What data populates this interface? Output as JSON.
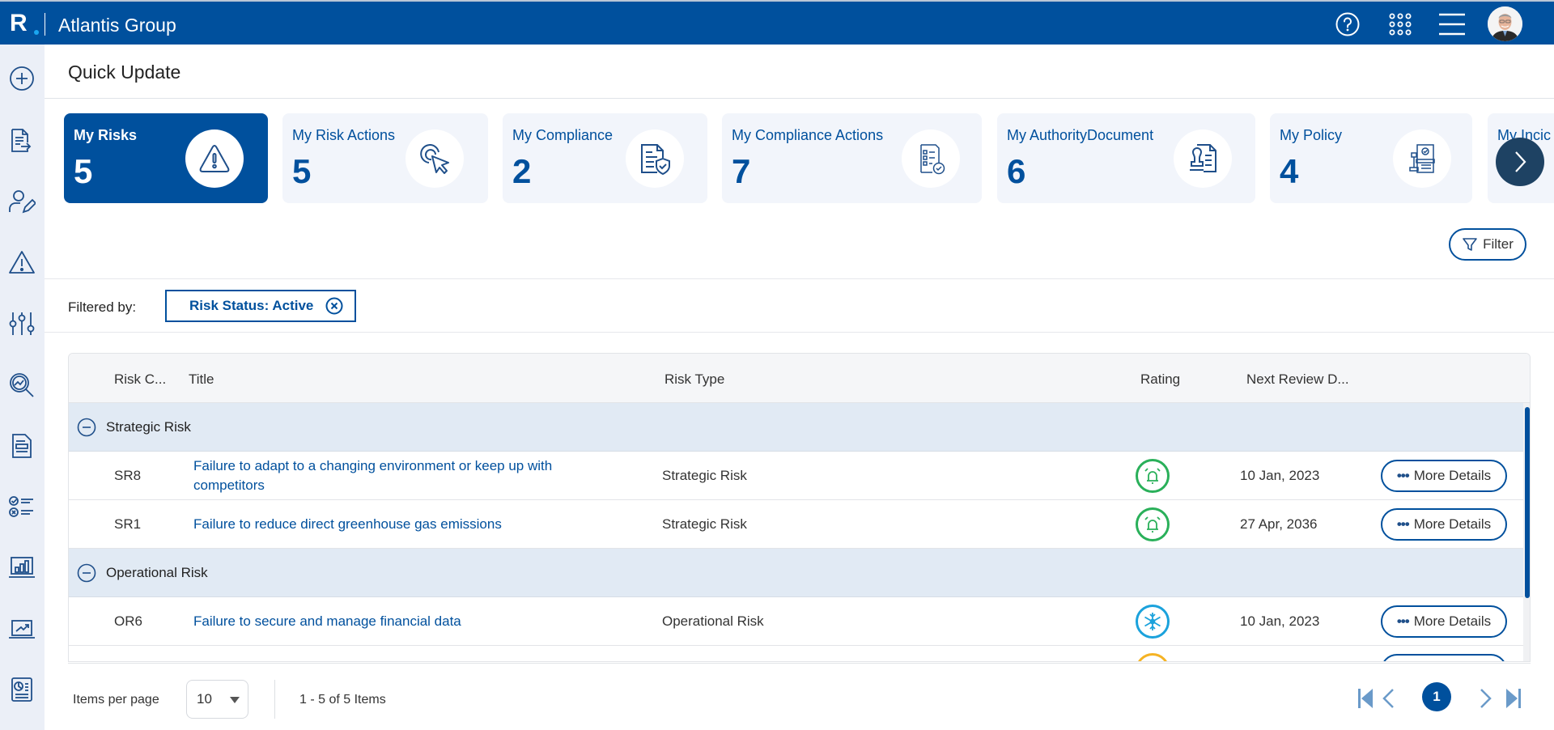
{
  "header": {
    "logo_letter": "R",
    "brand": "Atlantis Group",
    "icons": [
      "help-icon",
      "apps-grid-icon",
      "menu-icon",
      "user-avatar"
    ]
  },
  "sidebar": {
    "items": [
      {
        "name": "add-icon"
      },
      {
        "name": "document-export-icon"
      },
      {
        "name": "user-edit-icon"
      },
      {
        "name": "warning-icon"
      },
      {
        "name": "sliders-icon"
      },
      {
        "name": "search-analytics-icon"
      },
      {
        "name": "document-icon"
      },
      {
        "name": "checklist-icon"
      },
      {
        "name": "bar-chart-laptop-icon"
      },
      {
        "name": "trend-chart-icon"
      },
      {
        "name": "report-icon"
      }
    ]
  },
  "page": {
    "title": "Quick Update"
  },
  "cards": [
    {
      "title": "My Risks",
      "count": "5",
      "icon": "warning-icon",
      "active": true
    },
    {
      "title": "My Risk Actions",
      "count": "5",
      "icon": "click-cursor-icon",
      "active": false
    },
    {
      "title": "My Compliance",
      "count": "2",
      "icon": "document-shield-icon",
      "active": false
    },
    {
      "title": "My Compliance Actions",
      "count": "7",
      "icon": "checklist-approved-icon",
      "active": false
    },
    {
      "title": "My AuthorityDocument",
      "count": "6",
      "icon": "stamp-document-icon",
      "active": false
    },
    {
      "title": "My Policy",
      "count": "4",
      "icon": "policy-gavel-icon",
      "active": false
    },
    {
      "title": "My Incic",
      "count": "",
      "icon": "",
      "active": false
    }
  ],
  "filter": {
    "button_label": "Filter",
    "filtered_by_label": "Filtered by:",
    "chip_label": "Risk Status: Active"
  },
  "grid": {
    "columns": [
      "Risk C...",
      "Title",
      "Risk Type",
      "Rating",
      "Next Review D..."
    ],
    "groups": [
      {
        "label": "Strategic Risk",
        "rows": [
          {
            "code": "SR8",
            "title": "Failure to adapt to a changing environment or keep up with competitors",
            "type": "Strategic Risk",
            "rating": "alarm-bell",
            "rating_color": "#2ab05a",
            "date": "10 Jan, 2023",
            "action": "More Details"
          },
          {
            "code": "SR1",
            "title": "Failure to reduce direct greenhouse gas emissions",
            "type": "Strategic Risk",
            "rating": "alarm-bell",
            "rating_color": "#2ab05a",
            "date": "27 Apr, 2036",
            "action": "More Details"
          }
        ]
      },
      {
        "label": "Operational Risk",
        "rows": [
          {
            "code": "OR6",
            "title": "Failure to secure and manage financial data",
            "type": "Operational Risk",
            "rating": "snowflake",
            "rating_color": "#1ba2dc",
            "date": "10 Jan, 2023",
            "action": "More Details"
          },
          {
            "code": "",
            "title": "",
            "type": "",
            "rating": "flame",
            "rating_color": "#f5b324",
            "date": "",
            "action": ""
          }
        ]
      }
    ]
  },
  "pagination": {
    "items_per_page_label": "Items per page",
    "items_per_page_value": "10",
    "info": "1 - 5 of 5 Items",
    "current_page": "1"
  },
  "colors": {
    "brand": "#00509d",
    "sidebar_bg": "#ebeff7",
    "group_bg": "#e1eaf4"
  }
}
